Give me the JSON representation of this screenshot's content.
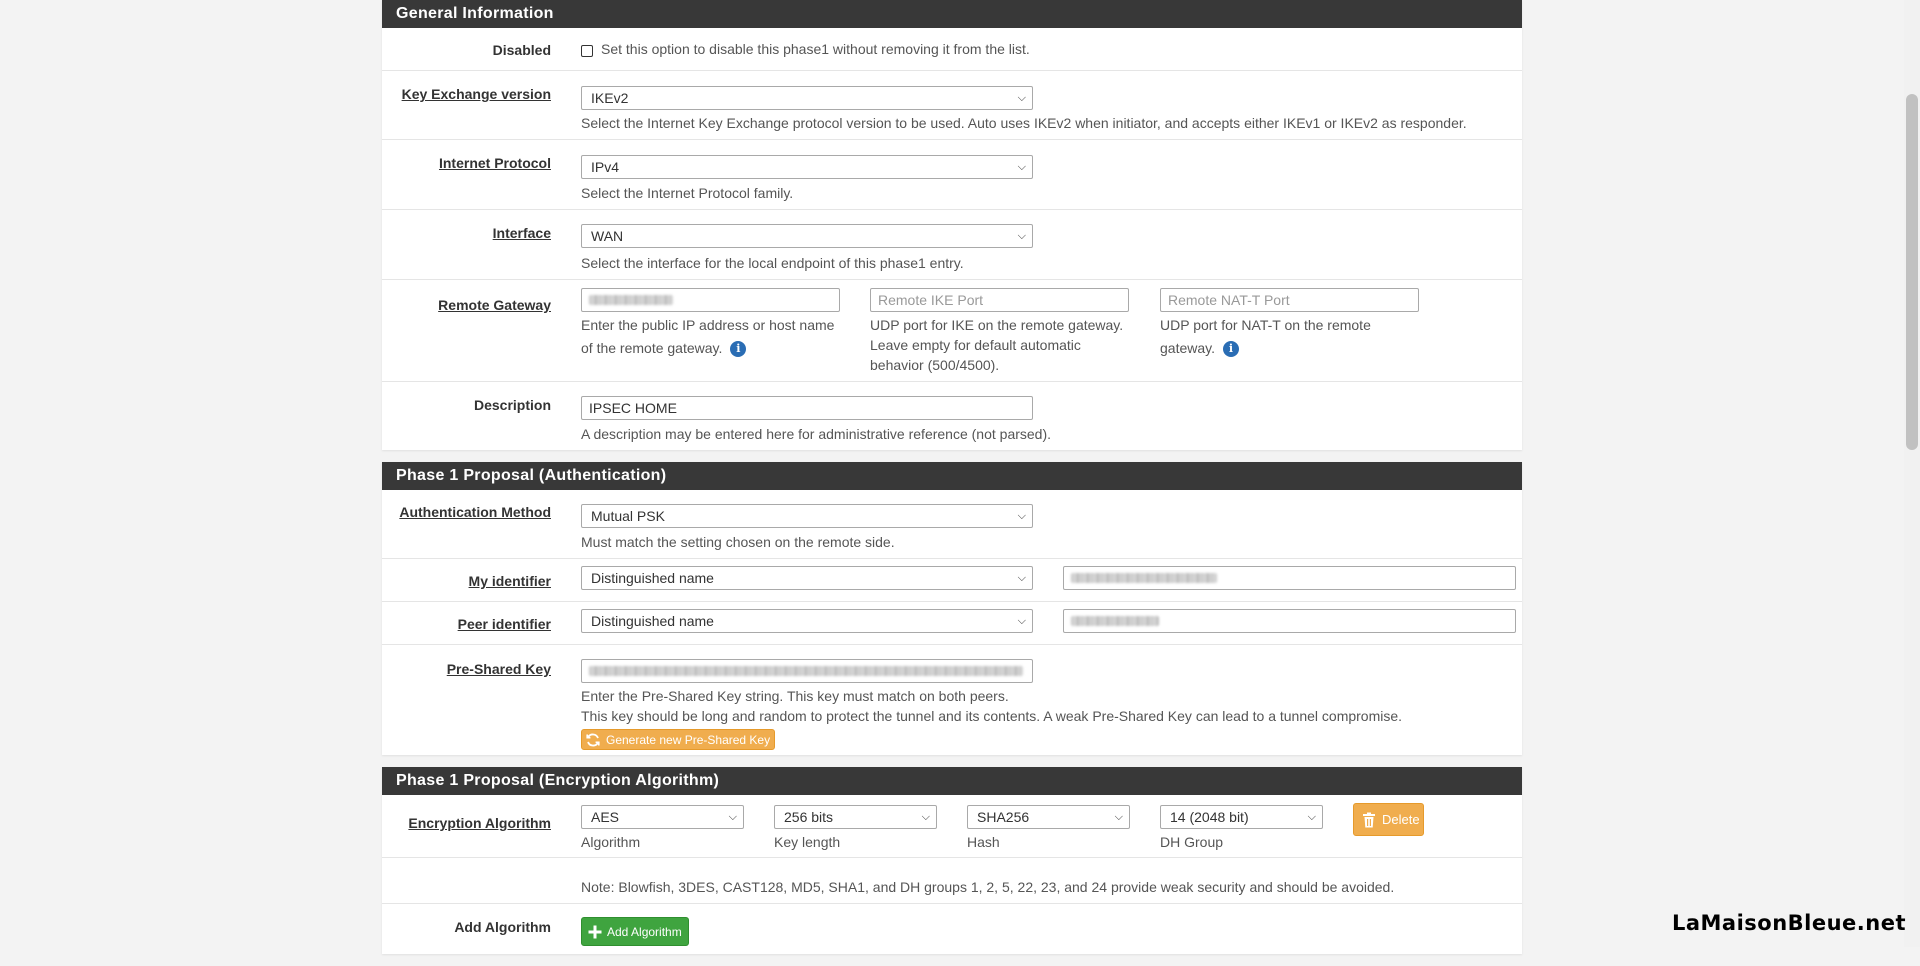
{
  "general": {
    "heading": "General Information",
    "disabled": {
      "label": "Disabled",
      "help": "Set this option to disable this phase1 without removing it from the list."
    },
    "key_exchange": {
      "label": "Key Exchange version",
      "value": "IKEv2",
      "help": "Select the Internet Key Exchange protocol version to be used. Auto uses IKEv2 when initiator, and accepts either IKEv1 or IKEv2 as responder."
    },
    "internet_protocol": {
      "label": "Internet Protocol",
      "value": "IPv4",
      "help": "Select the Internet Protocol family."
    },
    "interface": {
      "label": "Interface",
      "value": "WAN",
      "help": "Select the interface for the local endpoint of this phase1 entry."
    },
    "remote_gateway": {
      "label": "Remote Gateway",
      "help_host_line1": "Enter the public IP address or host name",
      "help_host_line2": "of the remote gateway.",
      "ike_port_placeholder": "Remote IKE Port",
      "ike_help_line1": "UDP port for IKE on the remote gateway.",
      "ike_help_line2": "Leave empty for default automatic",
      "ike_help_line3": "behavior (500/4500).",
      "natt_port_placeholder": "Remote NAT-T Port",
      "natt_help_line1": "UDP port for NAT-T on the remote",
      "natt_help_line2": "gateway."
    },
    "description": {
      "label": "Description",
      "value": "IPSEC HOME",
      "help": "A description may be entered here for administrative reference (not parsed)."
    }
  },
  "auth": {
    "heading": "Phase 1 Proposal (Authentication)",
    "method": {
      "label": "Authentication Method",
      "value": "Mutual PSK",
      "help": "Must match the setting chosen on the remote side."
    },
    "my_identifier": {
      "label": "My identifier",
      "value": "Distinguished name"
    },
    "peer_identifier": {
      "label": "Peer identifier",
      "value": "Distinguished name"
    },
    "psk": {
      "label": "Pre-Shared Key",
      "help_line1": "Enter the Pre-Shared Key string. This key must match on both peers.",
      "help_line2": "This key should be long and random to protect the tunnel and its contents. A weak Pre-Shared Key can lead to a tunnel compromise.",
      "generate_label": "Generate new Pre-Shared Key"
    }
  },
  "encryption": {
    "heading": "Phase 1 Proposal (Encryption Algorithm)",
    "label": "Encryption Algorithm",
    "algorithm": {
      "value": "AES",
      "caption": "Algorithm"
    },
    "key_length": {
      "value": "256 bits",
      "caption": "Key length"
    },
    "hash": {
      "value": "SHA256",
      "caption": "Hash"
    },
    "dh_group": {
      "value": "14 (2048 bit)",
      "caption": "DH Group"
    },
    "delete_label": "Delete",
    "note": "Note: Blowfish, 3DES, CAST128, MD5, SHA1, and DH groups 1, 2, 5, 22, 23, and 24 provide weak security and should be avoided.",
    "add_label": "Add Algorithm",
    "add_button_label": "Add Algorithm"
  },
  "watermark": "LaMaisonBleue.net",
  "icons": {
    "chevron": "chevron-down-icon",
    "info": "info-icon",
    "refresh": "refresh-icon",
    "trash": "trash-icon",
    "plus": "plus-icon"
  },
  "colors": {
    "heading_bg": "#383838",
    "info": "#2a6db4",
    "warning": "#f0ad4e",
    "success": "#3fa43f"
  }
}
